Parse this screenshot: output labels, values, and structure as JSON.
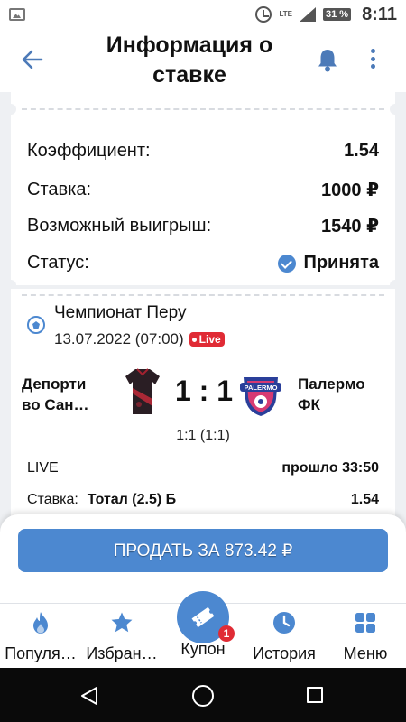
{
  "status_bar": {
    "lte": "LTE",
    "battery": "31 %",
    "time": "8:11"
  },
  "header": {
    "title": "Информация о ставке"
  },
  "summary": {
    "rows": [
      {
        "label": "Коэффициент:",
        "value": "1.54"
      },
      {
        "label": "Ставка:",
        "value": "1000 ₽"
      },
      {
        "label": "Возможный выигрыш:",
        "value": "1540 ₽"
      }
    ],
    "status_label": "Статус:",
    "status_value": "Принята"
  },
  "event": {
    "league": "Чемпионат Перу",
    "datetime": "13.07.2022 (07:00)",
    "live_badge": "Live",
    "team1": "Депорти во Сан…",
    "team2": "Палермо ФК",
    "team2_logo_text": "PALERMO",
    "score": "1 : 1",
    "score_detail": "1:1 (1:1)",
    "state": "LIVE",
    "elapsed": "прошло 33:50",
    "bet_label": "Ставка:",
    "bet_value": "Тотал (2.5) Б",
    "bet_odds": "1.54"
  },
  "sell_button": "ПРОДАТЬ ЗА 873.42 ₽",
  "bottom_nav": {
    "items": [
      {
        "label": "Популя…",
        "icon": "fire-icon"
      },
      {
        "label": "Избран…",
        "icon": "star-icon"
      },
      {
        "label": "Купон",
        "icon": "ticket-icon",
        "badge": "1"
      },
      {
        "label": "История",
        "icon": "clock-icon"
      },
      {
        "label": "Меню",
        "icon": "grid-icon"
      }
    ]
  },
  "colors": {
    "accent": "#4c88d0",
    "live": "#e02b35"
  }
}
